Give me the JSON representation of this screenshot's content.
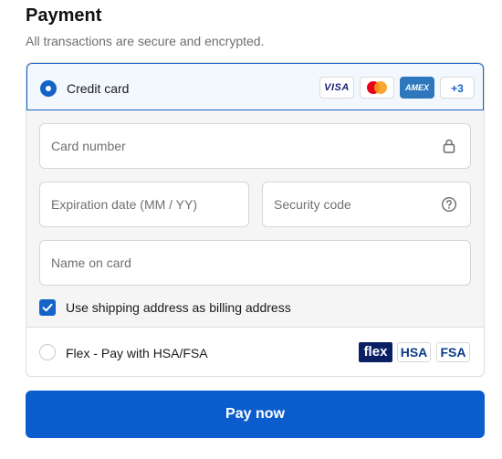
{
  "header": {
    "title": "Payment",
    "subtitle": "All transactions are secure and encrypted."
  },
  "credit_card": {
    "label": "Credit card",
    "selected": true,
    "brands": [
      "VISA",
      "mastercard",
      "AMEX"
    ],
    "visa_text": "VISA",
    "amex_text": "AMEX",
    "more_text": "+3"
  },
  "form": {
    "card_number_placeholder": "Card number",
    "expiration_placeholder": "Expiration date (MM / YY)",
    "security_code_placeholder": "Security code",
    "name_placeholder": "Name on card",
    "billing_checkbox_label": "Use shipping address as billing address",
    "billing_checked": true
  },
  "flex_option": {
    "label": "Flex - Pay with HSA/FSA",
    "selected": false,
    "badge_flex": "flex",
    "badge_hsa": "HSA",
    "badge_fsa": "FSA"
  },
  "pay_button": {
    "label": "Pay now"
  },
  "colors": {
    "accent": "#1463c7",
    "pay_button": "#0b5dce",
    "selected_row_bg": "#f3f8fe",
    "form_bg": "#f5f5f5"
  },
  "icons": {
    "card_field": "lock-icon",
    "security_field": "help-circle-icon",
    "checkbox": "check-icon"
  }
}
